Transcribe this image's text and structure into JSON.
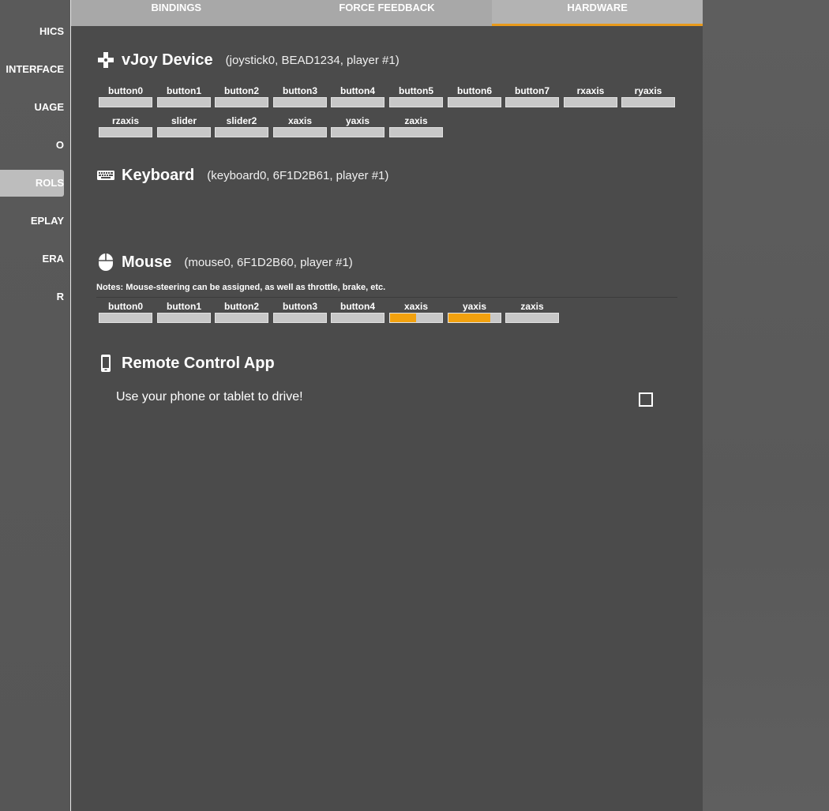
{
  "sidebar": {
    "items": [
      {
        "label": "HICS"
      },
      {
        "label": "INTERFACE"
      },
      {
        "label": "UAGE"
      },
      {
        "label": "O"
      },
      {
        "label": "ROLS"
      },
      {
        "label": "EPLAY"
      },
      {
        "label": "ERA"
      },
      {
        "label": "R"
      }
    ]
  },
  "tabs": [
    {
      "label": "BINDINGS"
    },
    {
      "label": "FORCE FEEDBACK"
    },
    {
      "label": "HARDWARE"
    }
  ],
  "vjoy": {
    "title": "vJoy Device",
    "subtitle": "(joystick0, BEAD1234, player #1)",
    "bindings": [
      {
        "label": "button0",
        "level": 0
      },
      {
        "label": "button1",
        "level": 0
      },
      {
        "label": "button2",
        "level": 0
      },
      {
        "label": "button3",
        "level": 0
      },
      {
        "label": "button4",
        "level": 0
      },
      {
        "label": "button5",
        "level": 0
      },
      {
        "label": "button6",
        "level": 0
      },
      {
        "label": "button7",
        "level": 0
      },
      {
        "label": "rxaxis",
        "level": 0
      },
      {
        "label": "ryaxis",
        "level": 0
      },
      {
        "label": "rzaxis",
        "level": 0
      },
      {
        "label": "slider",
        "level": 0
      },
      {
        "label": "slider2",
        "level": 0
      },
      {
        "label": "xaxis",
        "level": 0
      },
      {
        "label": "yaxis",
        "level": 0
      },
      {
        "label": "zaxis",
        "level": 0
      }
    ]
  },
  "keyboard": {
    "title": "Keyboard",
    "subtitle": "(keyboard0, 6F1D2B61, player #1)"
  },
  "mouse": {
    "title": "Mouse",
    "subtitle": "(mouse0, 6F1D2B60, player #1)",
    "notes": "Notes:  Mouse-steering can be assigned, as well as throttle, brake, etc.",
    "bindings": [
      {
        "label": "button0",
        "level": 0
      },
      {
        "label": "button1",
        "level": 0
      },
      {
        "label": "button2",
        "level": 0
      },
      {
        "label": "button3",
        "level": 0
      },
      {
        "label": "button4",
        "level": 0
      },
      {
        "label": "xaxis",
        "level": 0.5
      },
      {
        "label": "yaxis",
        "level": 0.8
      },
      {
        "label": "zaxis",
        "level": 0
      }
    ]
  },
  "remote": {
    "title": "Remote Control App",
    "option_label": "Use your phone or tablet to drive!",
    "checked": false
  },
  "colors": {
    "accent": "#f2a10e",
    "panel": "#4b4b4b",
    "tabbar": "#a8a8a8"
  }
}
